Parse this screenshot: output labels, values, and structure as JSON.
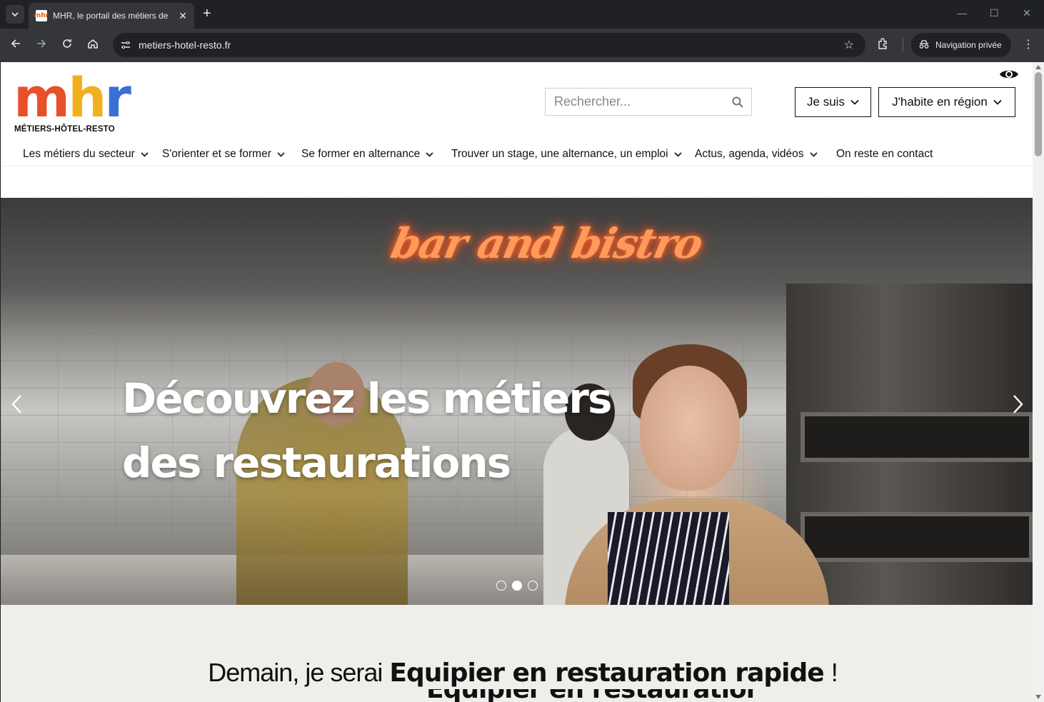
{
  "browser": {
    "tab_title": "MHR, le portail des métiers de l",
    "tab_favicon_text": "mhr",
    "url": "metiers-hotel-resto.fr",
    "incognito_label": "Navigation privée"
  },
  "header": {
    "logo_text": "mhr",
    "logo_letters": {
      "m": "m",
      "h": "h",
      "r": "r"
    },
    "logo_subtitle": "MÉTIERS-HÔTEL-RESTO",
    "search_placeholder": "Rechercher...",
    "je_suis": "Je suis",
    "region": "J'habite en région"
  },
  "nav": {
    "items": [
      {
        "label": "Les métiers du secteur",
        "has_dropdown": true
      },
      {
        "label": "S'orienter et se former",
        "has_dropdown": true
      },
      {
        "label": "Se former en alternance",
        "has_dropdown": true
      },
      {
        "label": "Trouver un stage, une alternance, un emploi",
        "has_dropdown": true
      },
      {
        "label": "Actus, agenda, vidéos",
        "has_dropdown": true
      },
      {
        "label": "On reste en contact",
        "has_dropdown": false
      }
    ]
  },
  "hero": {
    "neon_sign": "bar and bistro",
    "title_line1": "Découvrez les métiers",
    "title_line2": "des restaurations",
    "slide_count": 3,
    "active_slide": 2
  },
  "tagline": {
    "prefix": "Demain, je serai",
    "job": "Equipier en restauration rapide",
    "suffix": "!"
  },
  "colors": {
    "logo_m": "#e8502a",
    "logo_h": "#f2b01e",
    "logo_r": "#3a6fd6",
    "lower_bg": "#f0eeeb"
  }
}
